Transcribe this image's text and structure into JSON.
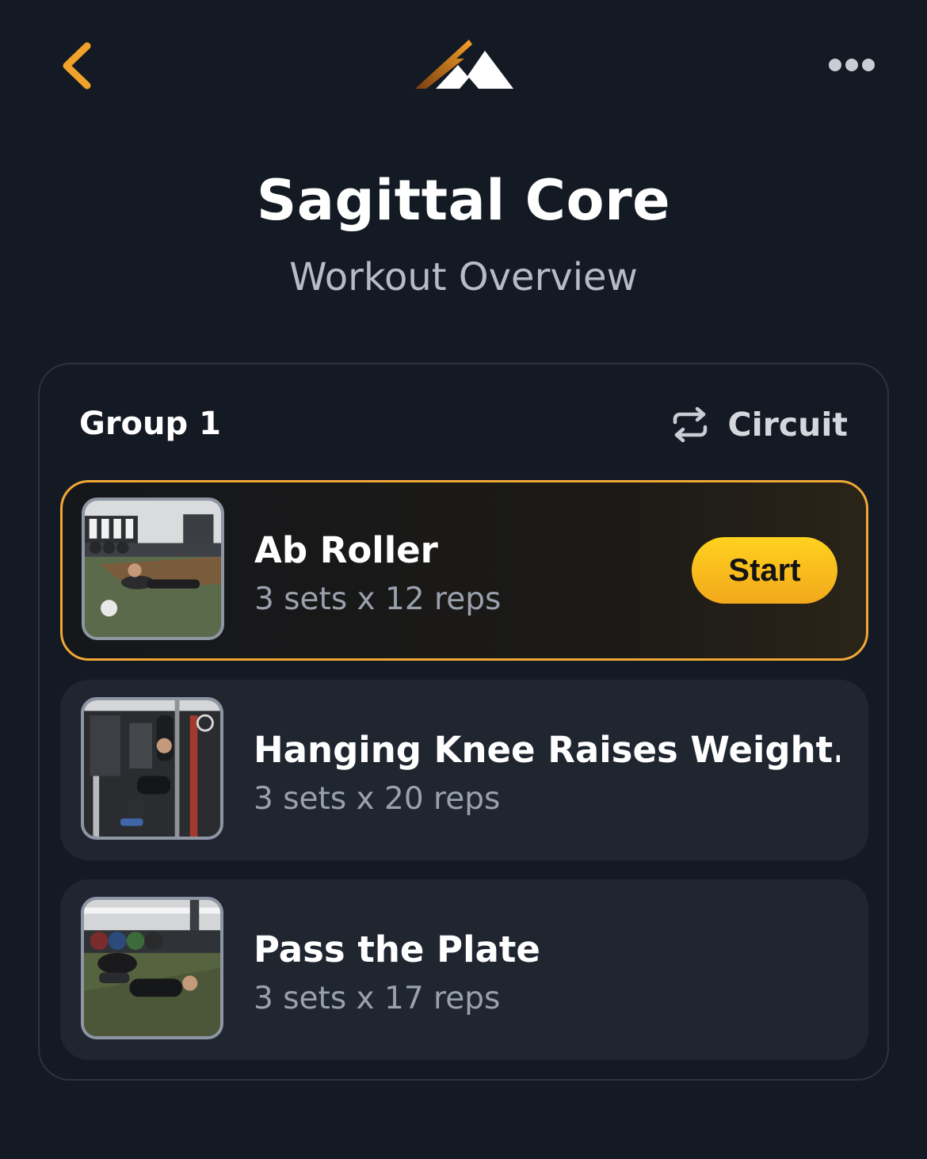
{
  "header": {
    "title": "Sagittal Core",
    "subtitle": "Workout Overview"
  },
  "icons": {
    "back": "chevron-left-icon",
    "logo": "mountain-logo",
    "more": "more-horizontal-icon",
    "circuit": "repeat-arrows-icon"
  },
  "colors": {
    "background": "#141a23",
    "accent": "#f0a735",
    "start_button": "#ffc61e",
    "card": "#1f2630"
  },
  "group": {
    "title": "Group 1",
    "mode_label": "Circuit"
  },
  "exercises": [
    {
      "name": "Ab Roller",
      "detail": "3 sets x 12 reps",
      "active": true,
      "action_label": "Start"
    },
    {
      "name": "Hanging Knee Raises Weight...",
      "detail": "3 sets x 20 reps",
      "active": false
    },
    {
      "name": "Pass the Plate",
      "detail": "3 sets x 17 reps",
      "active": false
    }
  ]
}
